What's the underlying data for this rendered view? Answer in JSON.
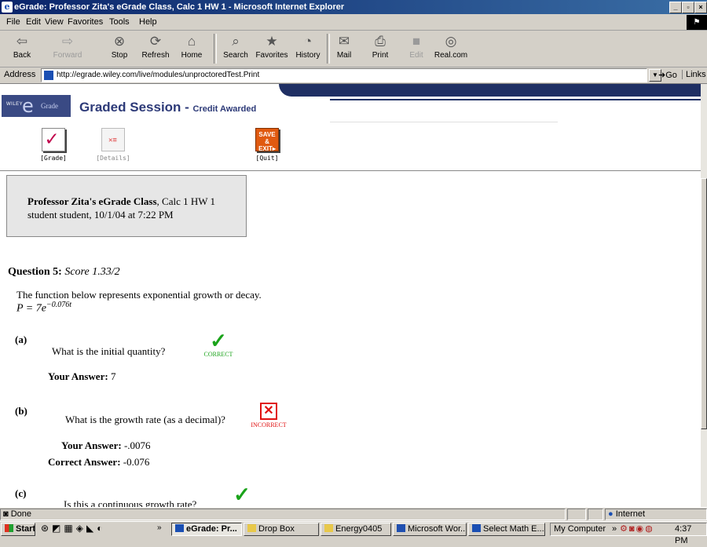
{
  "window": {
    "title": "eGrade: Professor Zita's eGrade Class, Calc 1 HW 1 - Microsoft Internet Explorer"
  },
  "menu": [
    "File",
    "Edit",
    "View",
    "Favorites",
    "Tools",
    "Help"
  ],
  "toolbar": {
    "back": "Back",
    "forward": "Forward",
    "stop": "Stop",
    "refresh": "Refresh",
    "home": "Home",
    "search": "Search",
    "favorites": "Favorites",
    "history": "History",
    "mail": "Mail",
    "print": "Print",
    "edit": "Edit",
    "realcom": "Real.com"
  },
  "address": {
    "label": "Address",
    "url": "http://egrade.wiley.com/live/modules/unproctoredTest.Print",
    "go": "Go",
    "links": "Links"
  },
  "header": {
    "logo_wiley": "WILEY",
    "logo_e": "e",
    "logo_grade": "Grade",
    "title": "Graded Session - ",
    "subtitle": "Credit Awarded",
    "nav": {
      "grade": "[Grade]",
      "details": "[Details]",
      "quit": "[Quit]",
      "quit_icon_line1": "SAVE &",
      "quit_icon_line2": "EXIT▸"
    }
  },
  "info": {
    "class_name": "Professor Zita's eGrade Class",
    "assignment": ", Calc 1 HW 1",
    "student_line": "student student, 10/1/04 at 7:22 PM"
  },
  "question": {
    "title": "Question 5:",
    "score": "Score 1.33/2",
    "text": "The function below represents exponential growth or decay.",
    "formula_base": "P = 7e",
    "formula_exp": "−0.076t",
    "parts": [
      {
        "label": "(a)",
        "question": "What is the initial quantity?",
        "status": "CORRECT",
        "your_answer_label": "Your Answer:",
        "your_answer": "7"
      },
      {
        "label": "(b)",
        "question": "What is the growth rate (as a decimal)?",
        "status": "INCORRECT",
        "your_answer_label": "Your Answer:",
        "your_answer": "-.0076",
        "correct_answer_label": "Correct Answer:",
        "correct_answer": "-0.076"
      },
      {
        "label": "(c)",
        "question": "Is this a continuous growth rate?"
      }
    ]
  },
  "statusbar": {
    "text": "Done",
    "zone": "Internet"
  },
  "taskbar": {
    "start": "Start",
    "tasks": [
      "eGrade: Pr...",
      "Drop Box",
      "Energy0405",
      "Microsoft Wor...",
      "Select Math E..."
    ],
    "tray_label": "My Computer",
    "clock": "4:37 PM"
  },
  "colors": {
    "title_gradient_start": "#0a246a",
    "header_navy": "#1f2f63",
    "session_title": "#2d3a78",
    "correct": "#1aa31a",
    "incorrect": "#e01010",
    "grade_check": "#c0004a"
  }
}
